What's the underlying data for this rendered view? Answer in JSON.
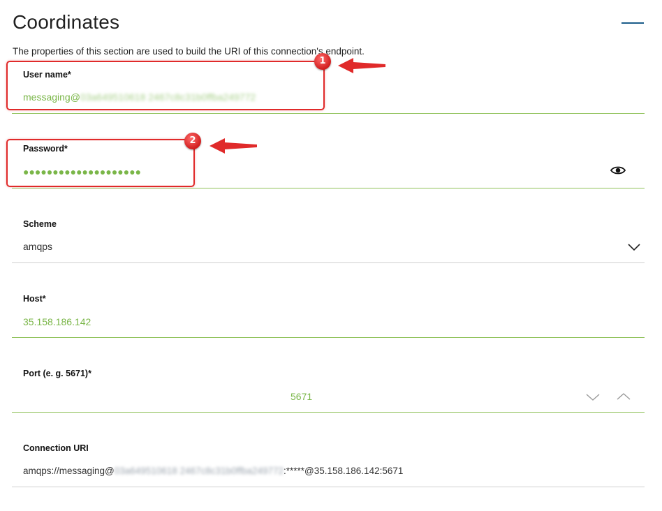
{
  "section": {
    "title": "Coordinates",
    "description": "The properties of this section are used to build the URI of this connection's endpoint.",
    "collapse_icon": "minus-icon"
  },
  "fields": {
    "user_name": {
      "label": "User name*",
      "value_prefix": "messaging@",
      "value_redacted": "03a649510618 2467c8c31b0ffba249772"
    },
    "password": {
      "label": "Password*",
      "value_masked": "●●●●●●●●●●●●●●●●●●●●",
      "toggle_icon": "eye-icon"
    },
    "scheme": {
      "label": "Scheme",
      "value": "amqps",
      "dropdown_icon": "chevron-down-icon"
    },
    "host": {
      "label": "Host*",
      "value": "35.158.186.142"
    },
    "port": {
      "label": "Port (e. g. 5671)*",
      "value": "5671",
      "decrement_icon": "chevron-down-icon",
      "increment_icon": "chevron-up-icon"
    },
    "connection_uri": {
      "label": "Connection URI",
      "prefix": "amqps://messaging@",
      "redacted": "03a649510618 2467c8c31b0ffba249772",
      "suffix": ":*****@35.158.186.142:5671"
    }
  },
  "annotations": [
    {
      "number": "1"
    },
    {
      "number": "2"
    }
  ],
  "colors": {
    "accent_green": "#7ab648",
    "annotation_red": "#e02a2a",
    "collapse_blue": "#1b5c8a"
  }
}
